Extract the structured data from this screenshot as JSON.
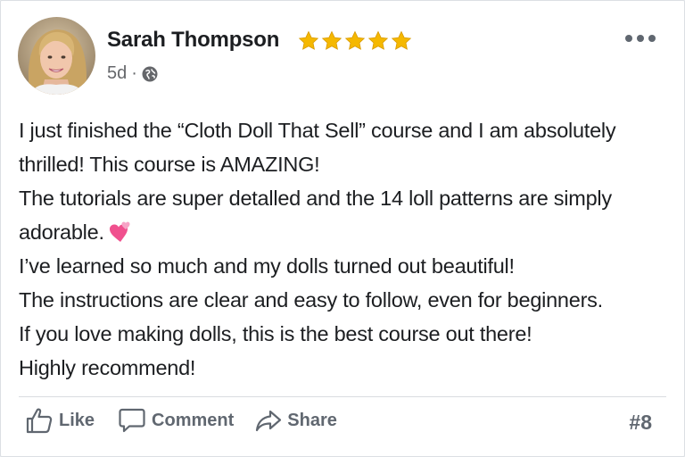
{
  "post": {
    "author": "Sarah Thompson",
    "rating": 5,
    "time": "5d",
    "separator": "·",
    "privacy_icon": "globe-icon",
    "body_lines": [
      "I just finished the “Cloth Doll That Sell” course and I am absolutely",
      "thrilled! This course is AMAZING!",
      "The tutorials are super detalled and the 14 loll patterns are simply",
      "adorable.",
      "I’ve learned so much and my dolls turned out beautiful!",
      "The instructions are clear and easy to follow, even for beginners.",
      "If you love making dolls, this is the best course out there!",
      "Highly recommend!"
    ],
    "emoji": "two-hearts-icon"
  },
  "actions": {
    "like_label": "Like",
    "comment_label": "Comment",
    "share_label": "Share"
  },
  "counter": "#8",
  "colors": {
    "text": "#1c1e21",
    "muted": "#65676b",
    "star": "#f5b800",
    "heart": "#f0508e"
  }
}
